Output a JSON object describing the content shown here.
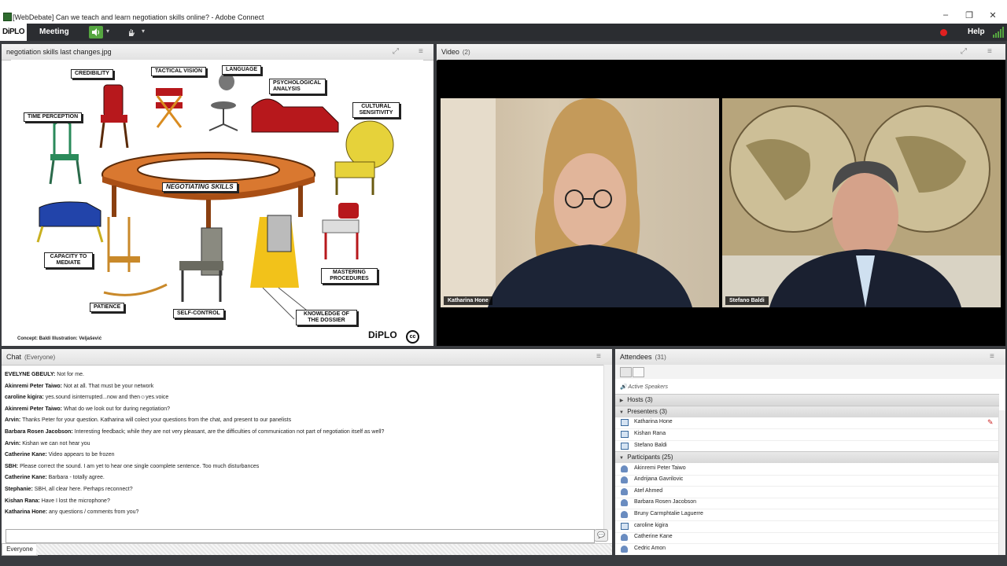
{
  "window": {
    "title": "[WebDebate] Can we teach and learn negotiation skills online? - Adobe Connect",
    "minimize": "–",
    "restore": "❐",
    "close": "✕"
  },
  "menubar": {
    "logo": "DiPLO",
    "meeting": "Meeting",
    "help": "Help"
  },
  "share_pod": {
    "title": "negotiation skills last changes.jpg"
  },
  "slide": {
    "center_label": "NEGOTIATING SKILLS",
    "labels": {
      "credibility": "CREDIBILITY",
      "tactical_vision": "TACTICAL VISION",
      "language": "LANGUAGE",
      "psychological_analysis": "PSYCHOLOGICAL ANALYSIS",
      "time_perception": "TIME PERCEPTION",
      "cultural_sensitivity": "CULTURAL SENSITIVITY",
      "capacity_to_mediate": "CAPACITY TO MEDIATE",
      "mastering_procedures": "MASTERING PROCEDURES",
      "patience": "PATIENCE",
      "self_control": "SELF-CONTROL",
      "knowledge_of_dossier": "KNOWLEDGE OF THE DOSSIER"
    },
    "credit": "Concept: Baldi   Illustration: Veljašević",
    "logo": "DiPLO",
    "cc": "cc"
  },
  "video_pod": {
    "title": "Video",
    "count": "(2)",
    "feeds": [
      {
        "name": "Katharina Hone"
      },
      {
        "name": "Stefano Baldi"
      }
    ]
  },
  "chat_pod": {
    "title": "Chat",
    "audience": "(Everyone)",
    "messages": [
      {
        "sender": "EVELYNE GBEULY:",
        "text": "Not for me."
      },
      {
        "sender": "Akinremi Peter Taiwo:",
        "text": "Not at all. That must be your network"
      },
      {
        "sender": "caroline kigira:",
        "text": "yes.sound isinterrupted...now and then☺yes.voice"
      },
      {
        "sender": "Akinremi Peter Taiwo:",
        "text": "What do we look out for during negotiation?"
      },
      {
        "sender": "Arvin:",
        "text": "Thanks Peter for your question. Katharina will colect your questions from the chat, and present  to our panelists"
      },
      {
        "sender": "Barbara Rosen Jacobson:",
        "text": "Interesting feedback; while they are not very pleasant, are the difficulties of communication not part of negotiation itself as well?"
      },
      {
        "sender": "Arvin:",
        "text": "Kishan we can not hear you"
      },
      {
        "sender": "Catherine Kane:",
        "text": "Video appears to be frozen"
      },
      {
        "sender": "SBH:",
        "text": "Please correct the sound. I am yet to hear one single coomplete sentence. Too much disturbances"
      },
      {
        "sender": "Catherine Kane:",
        "text": "Barbara - totally agree."
      },
      {
        "sender": "Stephanie:",
        "text": "SBH, all clear here. Perhaps reconnect?"
      },
      {
        "sender": "Kishan Rana:",
        "text": "Have I lost the microphone?"
      },
      {
        "sender": "Katharina Hone:",
        "text": "any questions / comments from you?"
      }
    ],
    "input_placeholder": "",
    "tab": "Everyone"
  },
  "attendees_pod": {
    "title": "Attendees",
    "count": "(31)",
    "active_speakers": "Active Speakers",
    "hosts": "Hosts (3)",
    "presenters": "Presenters (3)",
    "participants_group": "Participants (25)",
    "presenter_list": [
      "Katharina Hone",
      "Kishan Rana",
      "Stefano Baldi"
    ],
    "participant_list": [
      "Akinremi Peter Taiwo",
      "Andrijana Gavrilovic",
      "Atef Ahmed",
      "Barbara Rosen Jacobson",
      "Bruny Carmphtalie Laguerre",
      "caroline kigira",
      "Catherine Kane",
      "Cedric Amon"
    ]
  },
  "colors": {
    "accent_green": "#55a640",
    "record_red": "#e02020",
    "chrome_dark": "#2b2d31"
  }
}
